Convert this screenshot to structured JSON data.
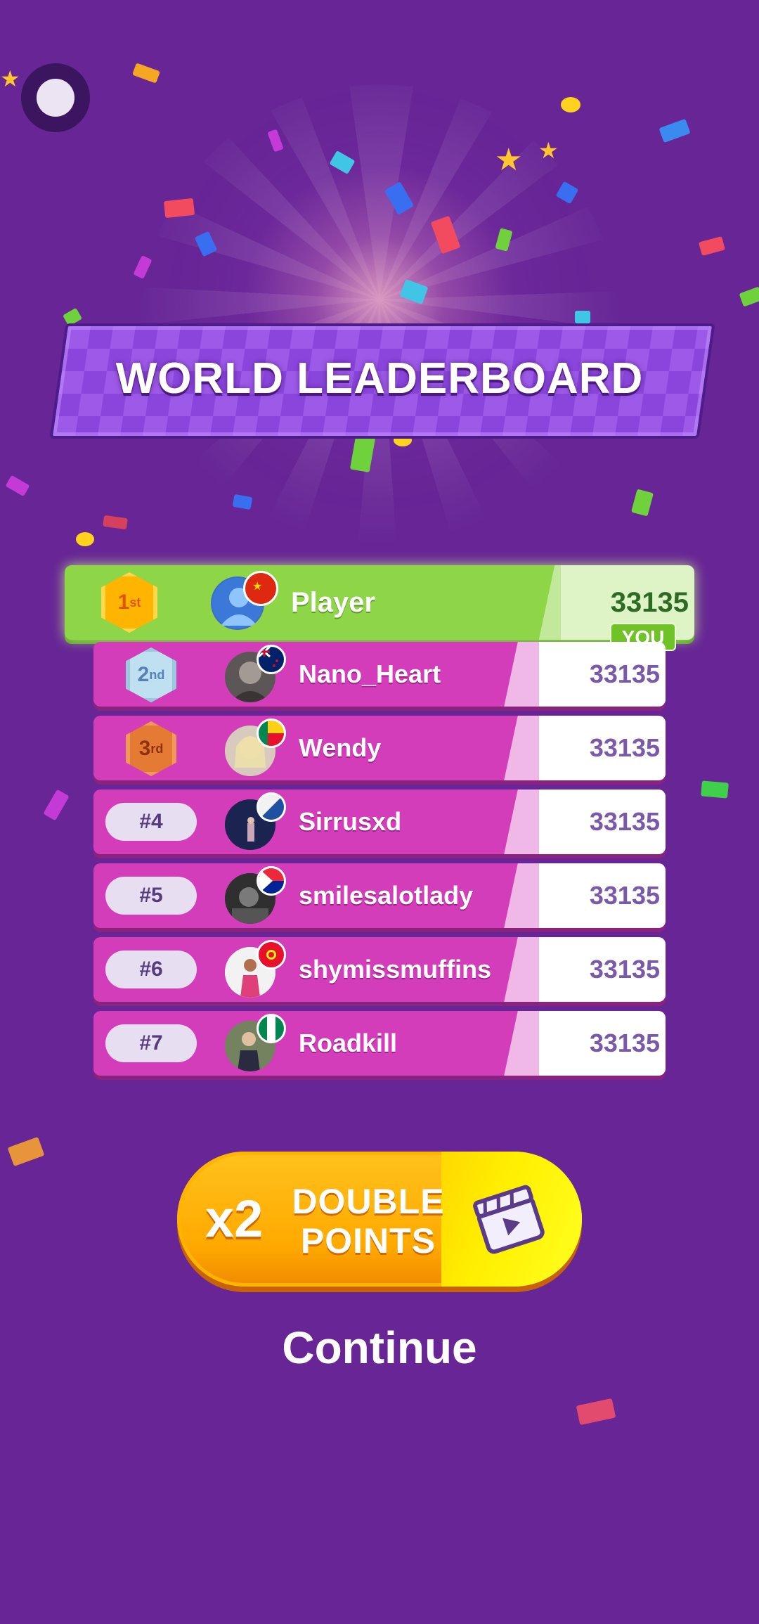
{
  "header": {
    "title": "WORLD LEADERBOARD"
  },
  "leaderboard": {
    "you_badge": "YOU",
    "entries": [
      {
        "rank": "1",
        "rank_suffix": "st",
        "name": "Player",
        "score": "33135",
        "flag": "china-flag-icon"
      },
      {
        "rank": "2",
        "rank_suffix": "nd",
        "name": "Nano_Heart",
        "score": "33135",
        "flag": "new-zealand-flag-icon"
      },
      {
        "rank": "3",
        "rank_suffix": "rd",
        "name": "Wendy",
        "score": "33135",
        "flag": "benin-flag-icon"
      },
      {
        "rank": "#4",
        "name": "Sirrusxd",
        "score": "33135",
        "flag": "aland-flag-icon"
      },
      {
        "rank": "#5",
        "name": "smilesalotlady",
        "score": "33135",
        "flag": "saint-martin-flag-icon"
      },
      {
        "rank": "#6",
        "name": "shymissmuffins",
        "score": "33135",
        "flag": "kyrgyzstan-flag-icon"
      },
      {
        "rank": "#7",
        "name": "Roadkill",
        "score": "33135",
        "flag": "nigeria-flag-icon"
      }
    ]
  },
  "double_points": {
    "multiplier": "x2",
    "line1": "DOUBLE",
    "line2": "POINTS",
    "icon": "video-clapper-icon"
  },
  "continue_label": "Continue",
  "colors": {
    "background": "#672596",
    "row": "#d43db9",
    "first_row": "#8fd548",
    "button": "#ffa900"
  }
}
